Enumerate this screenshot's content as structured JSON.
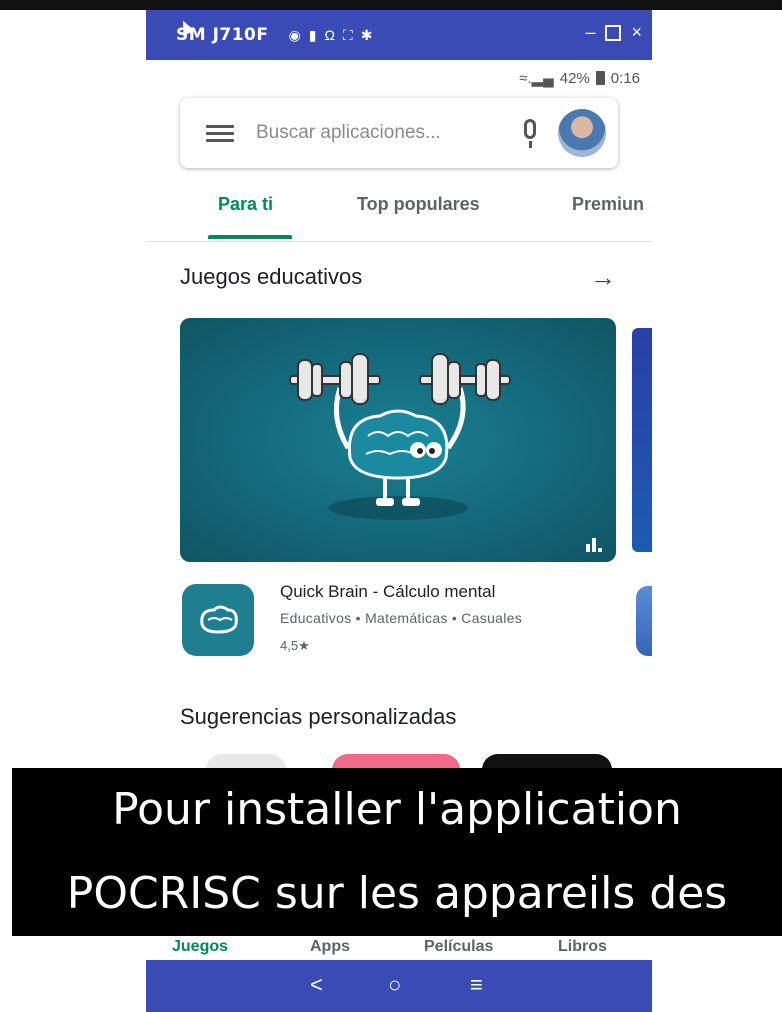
{
  "window": {
    "title": "SM J710F",
    "title_icons": [
      "camera-icon",
      "video-icon",
      "headset-icon",
      "fullscreen-icon",
      "settings-icon"
    ]
  },
  "status": {
    "battery": "42%",
    "time": "0:16"
  },
  "search": {
    "placeholder": "Buscar aplicaciones..."
  },
  "tabs": [
    {
      "label": "Para ti",
      "active": true
    },
    {
      "label": "Top populares",
      "active": false
    },
    {
      "label": "Premiun",
      "active": false
    }
  ],
  "section1": {
    "title": "Juegos educativos"
  },
  "app": {
    "name": "Quick Brain - Cálculo mental",
    "categories": "Educativos • Matemáticas • Casuales",
    "rating": "4,5★"
  },
  "section2": {
    "title": "Sugerencias personalizadas"
  },
  "bottom_nav": [
    {
      "label": "Juegos",
      "active": true
    },
    {
      "label": "Apps"
    },
    {
      "label": "Películas"
    },
    {
      "label": "Libros"
    }
  ],
  "android_nav": {
    "back": "<",
    "home": "○",
    "recents": "≡"
  },
  "caption": {
    "line1": "Pour installer l'application",
    "line2": "POCRISC sur les appareils des"
  },
  "colors": {
    "accent": "#01875f",
    "titlebar": "#3a4bb5",
    "banner": "#14687a"
  }
}
